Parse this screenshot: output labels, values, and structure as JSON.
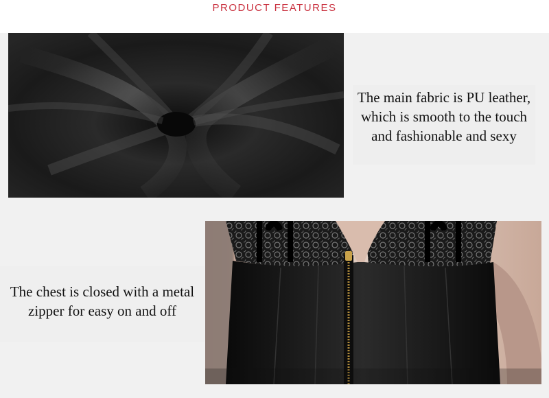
{
  "header": {
    "title": "PRODUCT FEATURES"
  },
  "features": [
    {
      "image_subject": "black PU leather fabric close-up",
      "caption_lines": [
        "The main fabric is PU leather,",
        "which is smooth to the touch",
        "and fashionable and sexy"
      ]
    },
    {
      "image_subject": "black corset with lace cups and front metal zipper",
      "caption_lines": [
        "The chest is closed with a metal",
        "zipper for easy on and off"
      ]
    }
  ],
  "colors": {
    "title": "#c9303e",
    "background": "#f1f1f1",
    "caption_text": "#111111"
  }
}
